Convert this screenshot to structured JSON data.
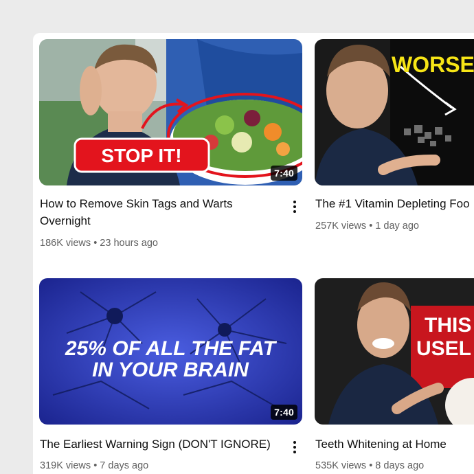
{
  "videos": [
    {
      "title": "How to Remove Skin Tags and Warts Overnight",
      "views": "186K views",
      "age": "23 hours ago",
      "duration": "7:40",
      "thumb_text": "STOP IT!"
    },
    {
      "title": "The #1 Vitamin Depleting Foo",
      "views": "257K views",
      "age": "1 day ago",
      "thumb_text": "WORSE T"
    },
    {
      "title": "The Earliest Warning Sign (DON'T IGNORE)",
      "views": "319K views",
      "age": "7 days ago",
      "duration": "7:40",
      "thumb_line1": "25% OF ALL THE FAT",
      "thumb_line2": "IN YOUR BRAIN"
    },
    {
      "title": "Teeth Whitening at Home",
      "views": "535K views",
      "age": "8 days ago",
      "thumb_line1": "THIS",
      "thumb_line2": "USEL"
    }
  ],
  "separator": "•",
  "colors": {
    "accent_red": "#e3141d",
    "yellow": "#f7e516",
    "brain_blue": "#2a3bbd"
  }
}
